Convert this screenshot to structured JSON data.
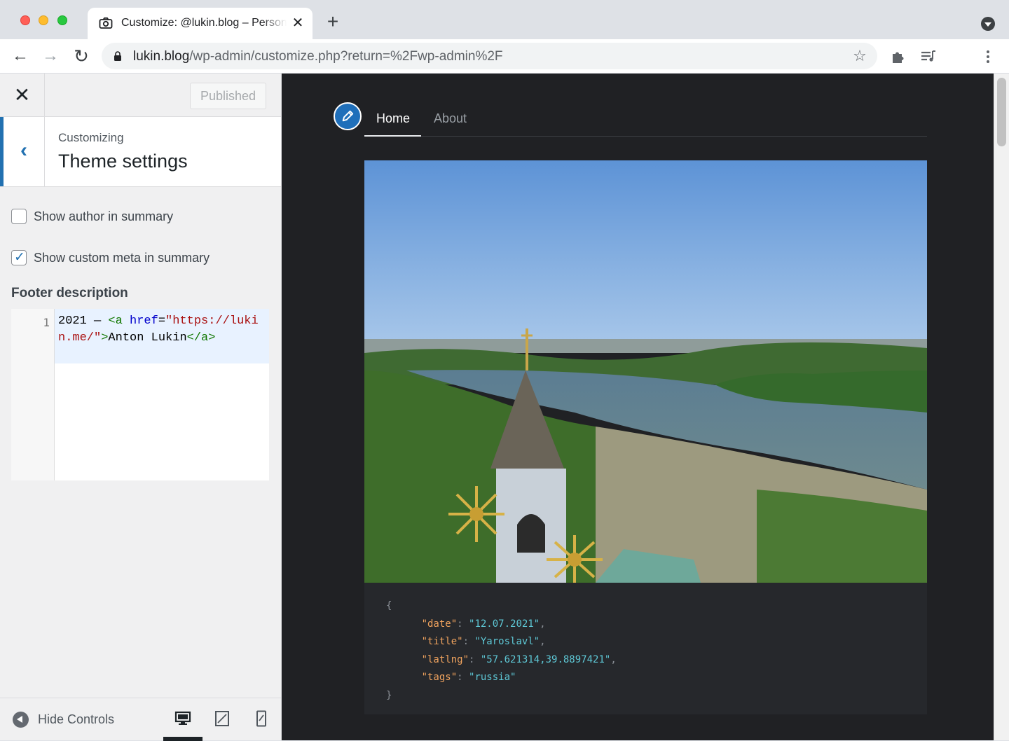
{
  "browser": {
    "tab_title": "Customize: @lukin.blog – Personal",
    "url_host": "lukin.blog",
    "url_path": "/wp-admin/customize.php?return=%2Fwp-admin%2F"
  },
  "customizer": {
    "published_label": "Published",
    "breadcrumb": "Customizing",
    "section_title": "Theme settings",
    "show_author_label": "Show author in summary",
    "show_author_checked": false,
    "show_custom_meta_label": "Show custom meta in summary",
    "show_custom_meta_checked": true,
    "footer_description_label": "Footer description",
    "footer_code_line_number": "1",
    "footer_code": {
      "year": "2021 — ",
      "tag_open": "<a",
      "attr": "href",
      "eq": "=",
      "href": "\"https://lukin.me/\"",
      "tag_close_bracket": ">",
      "text": "Anton Lukin",
      "tag_end": "</a>"
    },
    "hide_controls_label": "Hide Controls",
    "active_device": "desktop"
  },
  "site": {
    "nav": {
      "home": "Home",
      "about": "About"
    },
    "post_meta": {
      "open": "{",
      "close": "}",
      "date_key": "\"date\"",
      "date_val": "\"12.07.2021\"",
      "title_key": "\"title\"",
      "title_val": "\"Yaroslavl\"",
      "latlng_key": "\"latlng\"",
      "latlng_val": "\"57.621314,39.8897421\"",
      "tags_key": "\"tags\"",
      "tags_val": "\"russia\""
    }
  },
  "colors": {
    "wp_accent": "#2271b1",
    "preview_bg": "#202124",
    "meta_key": "#f0a35e",
    "meta_value": "#5ec8d6"
  },
  "icons": {
    "tab": "camera-icon",
    "back": "arrow-left-icon",
    "forward": "arrow-right-icon",
    "reload": "reload-icon",
    "lock": "lock-icon",
    "bookmark": "star-icon",
    "extensions": "puzzle-icon",
    "media": "media-queue-icon",
    "menu": "kebab-menu-icon",
    "site_logo": "pencil-icon"
  }
}
